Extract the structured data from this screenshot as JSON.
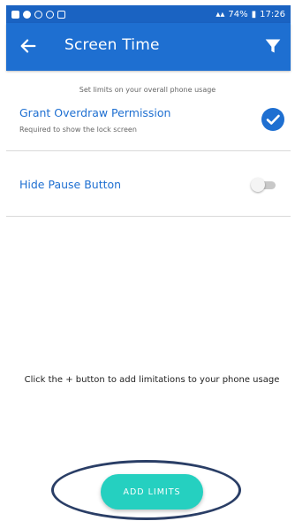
{
  "status_bar": {
    "right_text": "74%",
    "time": "17:26",
    "color": "#1a63c2"
  },
  "toolbar": {
    "title": "Screen Time",
    "back_icon": "arrow-left-icon",
    "filter_icon": "filter-icon",
    "color": "#1e6fd1"
  },
  "settings": {
    "hint": "Set limits on your overall phone usage",
    "overdraw": {
      "title": "Grant Overdraw Permission",
      "subtitle": "Required to show the lock screen",
      "checked": true
    },
    "hide_pause": {
      "title": "Hide Pause Button",
      "enabled": false
    }
  },
  "empty_state": {
    "message": "Click the + button to add limitations to your phone usage"
  },
  "add_button": {
    "label": "ADD LIMITS",
    "color": "#25d0c0"
  }
}
